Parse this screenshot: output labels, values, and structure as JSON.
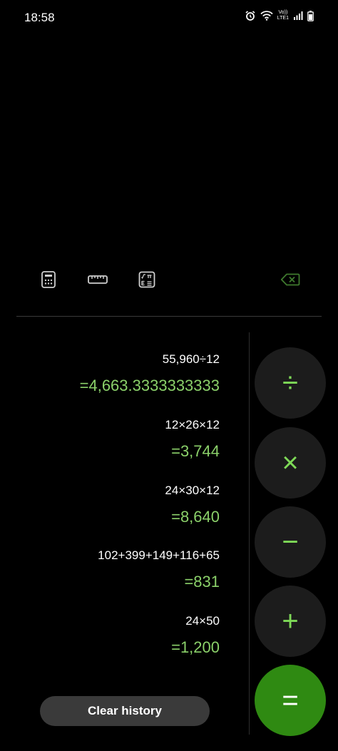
{
  "status_bar": {
    "time": "18:58",
    "lte_top": "Vo))",
    "lte_bottom": "LTE1"
  },
  "toolbar": {
    "icons": [
      "calculator-icon",
      "ruler-icon",
      "scientific-icon",
      "backspace-icon"
    ]
  },
  "history": [
    {
      "expression": "55,960÷12",
      "result": "=4,663.3333333333"
    },
    {
      "expression": "12×26×12",
      "result": "=3,744"
    },
    {
      "expression": "24×30×12",
      "result": "=8,640"
    },
    {
      "expression": "102+399+149+116+65",
      "result": "=831"
    },
    {
      "expression": "24×50",
      "result": "=1,200"
    }
  ],
  "operators": {
    "divide": "÷",
    "multiply": "×",
    "subtract": "−",
    "add": "+",
    "equals": "="
  },
  "clear_history_label": "Clear history",
  "colors": {
    "accent_green": "#7ed957",
    "result_green": "#8bd16a",
    "equals_bg": "#2f8a12",
    "button_bg": "#1c1c1c"
  }
}
